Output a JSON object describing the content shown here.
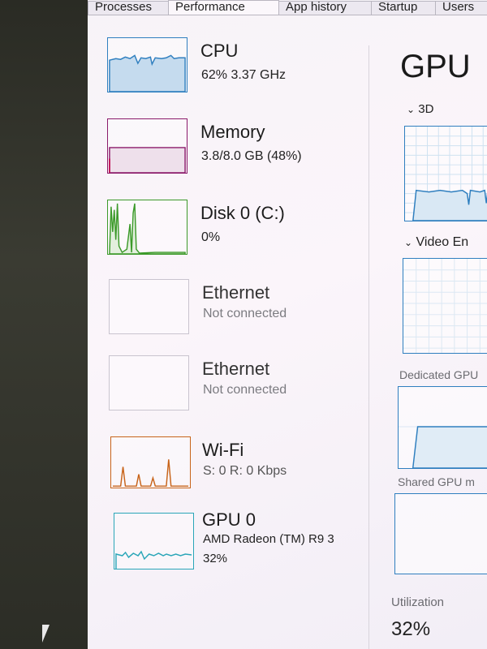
{
  "tabs": [
    {
      "label": "Processes"
    },
    {
      "label": "Performance"
    },
    {
      "label": "App history"
    },
    {
      "label": "Startup"
    },
    {
      "label": "Users"
    }
  ],
  "sidebar": {
    "items": [
      {
        "title": "CPU",
        "subtitle": "62%  3.37 GHz"
      },
      {
        "title": "Memory",
        "subtitle": "3.8/8.0 GB (48%)"
      },
      {
        "title": "Disk 0 (C:)",
        "subtitle": "0%"
      },
      {
        "title": "Ethernet",
        "subtitle": "Not connected"
      },
      {
        "title": "Ethernet",
        "subtitle": "Not connected"
      },
      {
        "title": "Wi-Fi",
        "subtitle": "S: 0 R: 0 Kbps"
      },
      {
        "title": "GPU 0",
        "subtitle": "AMD Radeon (TM) R9 3",
        "subtitle2": "32%"
      }
    ]
  },
  "detail": {
    "title": "GPU",
    "engine1": "3D",
    "engine2": "Video En",
    "dedicated": "Dedicated GPU",
    "shared": "Shared GPU m",
    "util_label": "Utilization",
    "util_value": "32%"
  },
  "colors": {
    "cpu": "#2f7fbf",
    "memory": "#8b1a6b",
    "disk": "#3c9a2a",
    "ethernet": "#c9c4cf",
    "wifi": "#c8641a",
    "gpu": "#2aa6b8"
  }
}
